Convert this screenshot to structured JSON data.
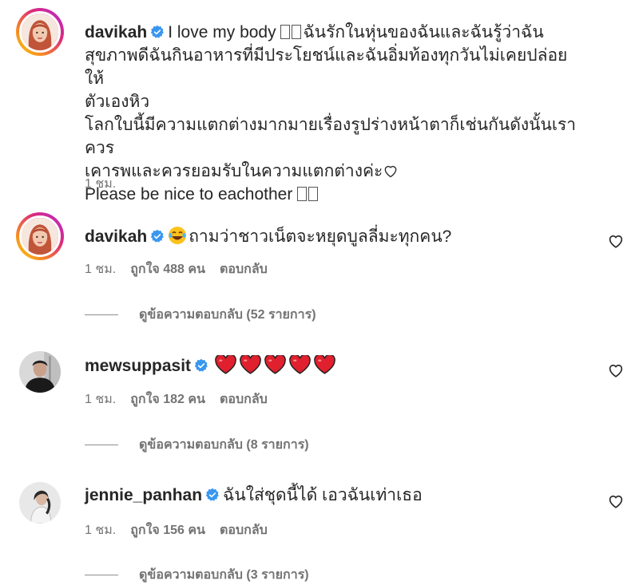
{
  "caption": {
    "username": "davikah",
    "line1": "I love my body",
    "line1b": "ฉันรักในหุ่นของฉันและฉันรู้ว่าฉัน",
    "line2": "สุขภาพดีฉันกินอาหารที่มีประโยชน์และฉันอิ่มท้องทุกวันไม่เคยปล่อยให้",
    "line3": "ตัวเองหิว",
    "line4": "โลกใบนี้มีความแตกต่างมากมายเรื่องรูปร่างหน้าตาก็เช่นกันดังนั้นเราควร",
    "line5": "เคารพและควรยอมรับในความแตกต่างค่ะ",
    "line6": "Please be nice to eachother",
    "time": "1 ชม."
  },
  "comments": [
    {
      "username": "davikah",
      "text": "ถามว่าชาวเน็ตจะหยุดบูลลี่มะทุกคน?",
      "time": "1 ชม.",
      "likes": "ถูกใจ 488 คน",
      "reply": "ตอบกลับ",
      "view_replies": "ดูข้อความตอบกลับ (52 รายการ)"
    },
    {
      "username": "mewsuppasit",
      "text": "",
      "time": "1 ชม.",
      "likes": "ถูกใจ 182 คน",
      "reply": "ตอบกลับ",
      "view_replies": "ดูข้อความตอบกลับ (8 รายการ)"
    },
    {
      "username": "jennie_panhan",
      "text": "ฉันใส่ชุดนี้ได้ เอวฉันเท่าเธอ",
      "time": "1 ชม.",
      "likes": "ถูกใจ 156 คน",
      "reply": "ตอบกลับ",
      "view_replies": "ดูข้อความตอบกลับ (3 รายการ)"
    }
  ],
  "icons": {
    "verified": "verified-badge-icon",
    "like": "heart-outline-icon",
    "red_heart": "red-heart-emoji",
    "laughing": "tears-of-joy-emoji"
  },
  "colors": {
    "verified_blue": "#3897f0",
    "heart_red": "#e0202e",
    "meta_gray": "#737373"
  }
}
